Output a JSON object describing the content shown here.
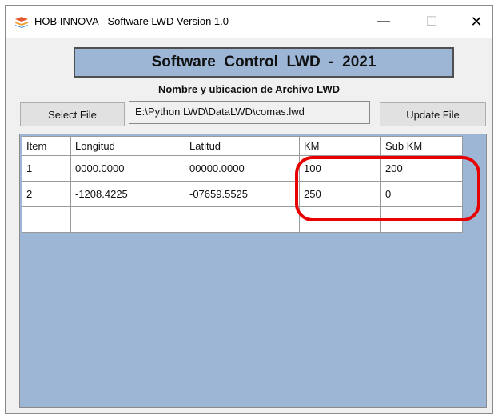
{
  "window": {
    "title": "HOB INNOVA - Software LWD Version 1.0",
    "icon": "stacked-layers-icon",
    "controls": {
      "minimize": "—",
      "maximize": "☐",
      "close": "✕"
    }
  },
  "banner": {
    "title": "Software  Control  LWD  -  2021"
  },
  "file_section": {
    "heading": "Nombre y ubicacion de Archivo LWD",
    "select_label": "Select File",
    "path_value": "E:\\Python LWD\\DataLWD\\comas.lwd",
    "update_label": "Update File"
  },
  "table": {
    "headers": [
      "Item",
      "Longitud",
      "Latitud",
      "KM",
      "Sub KM"
    ],
    "rows": [
      [
        "1",
        "0000.0000",
        "00000.0000",
        "100",
        "200"
      ],
      [
        "2",
        "-1208.4225",
        "-07659.5525",
        "250",
        "0"
      ],
      [
        "",
        "",
        "",
        "",
        ""
      ]
    ]
  },
  "colors": {
    "banner_bg": "#9db6d6",
    "grid_bg": "#9db6d6",
    "highlight": "#e60000",
    "window_bg": "#f0f0f0"
  }
}
